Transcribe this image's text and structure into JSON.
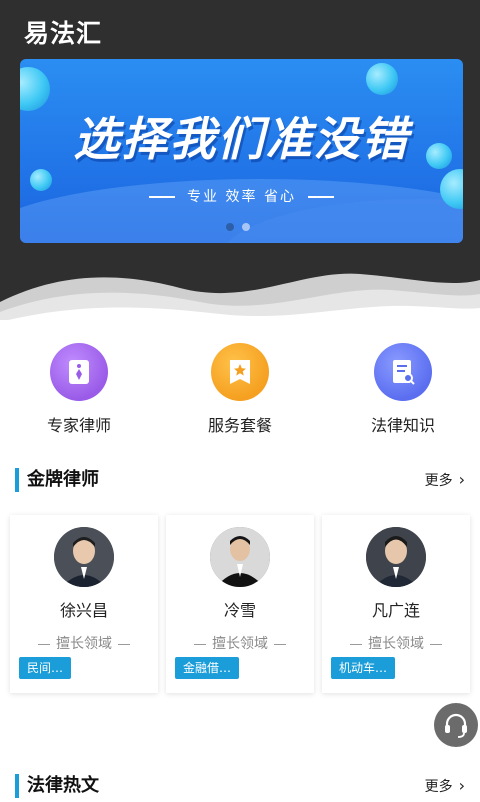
{
  "app": {
    "title": "易法汇"
  },
  "banner": {
    "headline": "选择我们准没错",
    "subtitle": "专业  效率  省心",
    "slides": 2,
    "active_slide": 0
  },
  "categories": [
    {
      "label": "专家律师",
      "icon": "lawyer-tie-icon",
      "color": "#9a5ce8"
    },
    {
      "label": "服务套餐",
      "icon": "package-star-icon",
      "color": "#f5a020"
    },
    {
      "label": "法律知识",
      "icon": "document-search-icon",
      "color": "#5b6ef0"
    }
  ],
  "gold_lawyers": {
    "title": "金牌律师",
    "more": "更多",
    "specialty_caption": "擅长领域",
    "items": [
      {
        "name": "徐兴昌",
        "tag": "民间…"
      },
      {
        "name": "冷雪",
        "tag": "金融借…"
      },
      {
        "name": "凡广连",
        "tag": "机动车…"
      }
    ]
  },
  "legal_articles": {
    "title": "法律热文",
    "more": "更多"
  },
  "support": {
    "icon": "headset-icon"
  },
  "colors": {
    "accent": "#1a9dd9",
    "header_bg": "#2f2f2f"
  }
}
